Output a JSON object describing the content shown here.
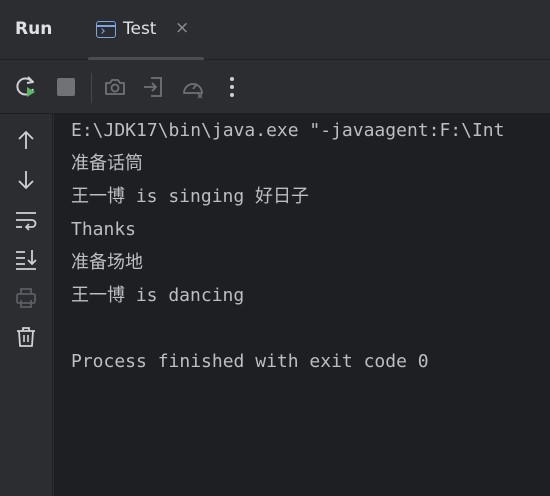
{
  "header": {
    "title": "Run",
    "tab": {
      "label": "Test",
      "close": "×"
    }
  },
  "toolbar": {
    "buttons": [
      "rerun-icon",
      "stop-icon",
      "screenshot-icon",
      "export-icon",
      "profiler-icon",
      "more-options-icon"
    ]
  },
  "gutter": {
    "buttons": [
      "up-arrow-icon",
      "down-arrow-icon",
      "soft-wrap-icon",
      "scroll-to-end-icon",
      "print-icon",
      "trash-icon"
    ]
  },
  "console": {
    "lines": [
      "E:\\JDK17\\bin\\java.exe \"-javaagent:F:\\Int",
      "准备话筒",
      "王一博 is singing 好日子",
      "Thanks",
      "准备场地",
      "王一博 is dancing",
      "",
      "Process finished with exit code 0"
    ]
  },
  "colors": {
    "background": "#2b2d30",
    "console_background": "#1e1f22",
    "text": "#bcbec4",
    "accent_green": "#5fb865",
    "accent_blue": "#7ea5e0"
  }
}
